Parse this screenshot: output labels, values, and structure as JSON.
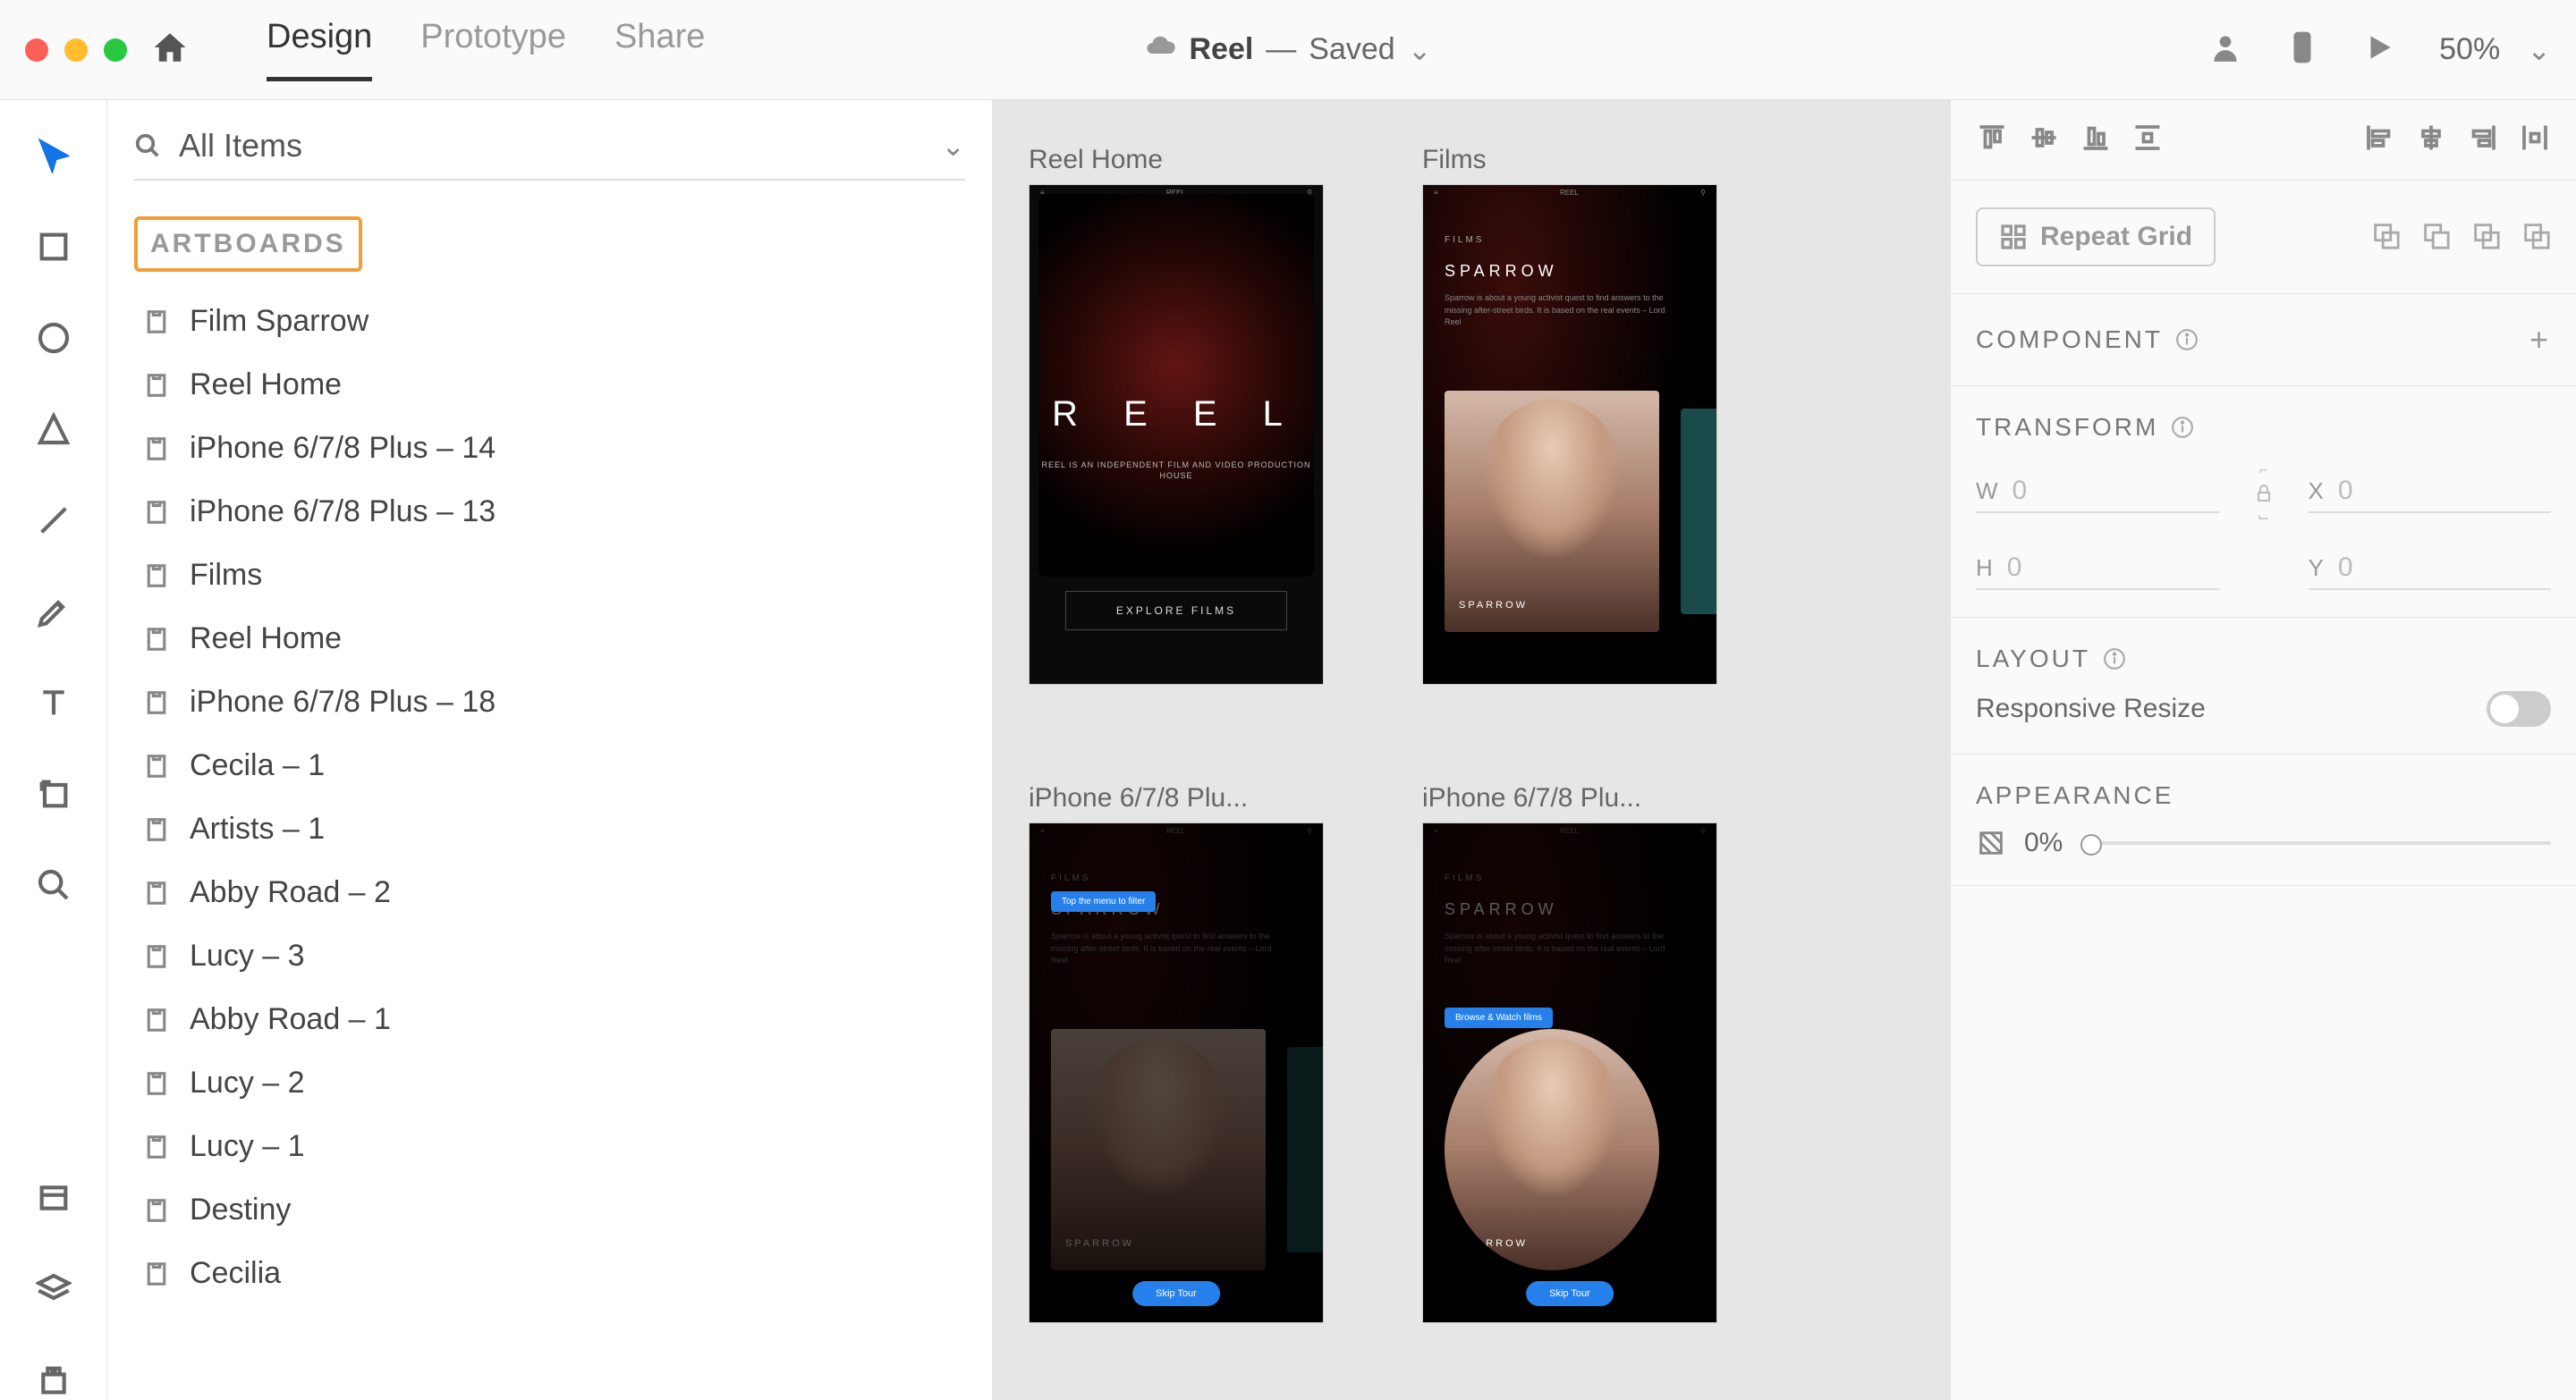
{
  "topbar": {
    "tabs": {
      "design": "Design",
      "prototype": "Prototype",
      "share": "Share"
    },
    "doc_name": "Reel",
    "separator": "—",
    "status": "Saved",
    "zoom": "50%"
  },
  "search": {
    "placeholder": "All Items"
  },
  "artboards_heading": "ARTBOARDS",
  "artboards": [
    "Film Sparrow",
    "Reel Home",
    "iPhone 6/7/8 Plus – 14",
    "iPhone 6/7/8 Plus – 13",
    "Films",
    "Reel Home",
    "iPhone 6/7/8 Plus – 18",
    "Cecila – 1",
    "Artists – 1",
    "Abby Road – 2",
    "Lucy – 3",
    "Abby Road – 1",
    "Lucy – 2",
    "Lucy – 1",
    "Destiny",
    "Cecilia"
  ],
  "canvas": {
    "labels": [
      "Reel Home",
      "Films",
      "iPhone 6/7/8 Plu...",
      "iPhone 6/7/8 Plu..."
    ],
    "reel_home": {
      "title": "R E E L",
      "sub": "REEL IS AN INDEPENDENT FILM\nAND VIDEO PRODUCTION HOUSE",
      "btn": "EXPLORE FILMS"
    },
    "films": {
      "heading": "FILMS",
      "title": "SPARROW",
      "desc": "Sparrow is about a young activist quest to find answers to the missing after-street birds. It is based on the real events – Lord Reel",
      "card_title": "SPARROW"
    },
    "tutorial1": {
      "tooltip": "Top the menu to filter",
      "btn": "Skip Tour"
    },
    "tutorial2": {
      "tooltip": "Browse & Watch films",
      "btn": "Skip Tour"
    }
  },
  "inspector": {
    "repeat_grid": "Repeat Grid",
    "component": "COMPONENT",
    "transform": "TRANSFORM",
    "transform_vals": {
      "w": "0",
      "h": "0",
      "x": "0",
      "y": "0"
    },
    "layout": "LAYOUT",
    "responsive": "Responsive Resize",
    "appearance": "APPEARANCE",
    "opacity": "0%"
  }
}
